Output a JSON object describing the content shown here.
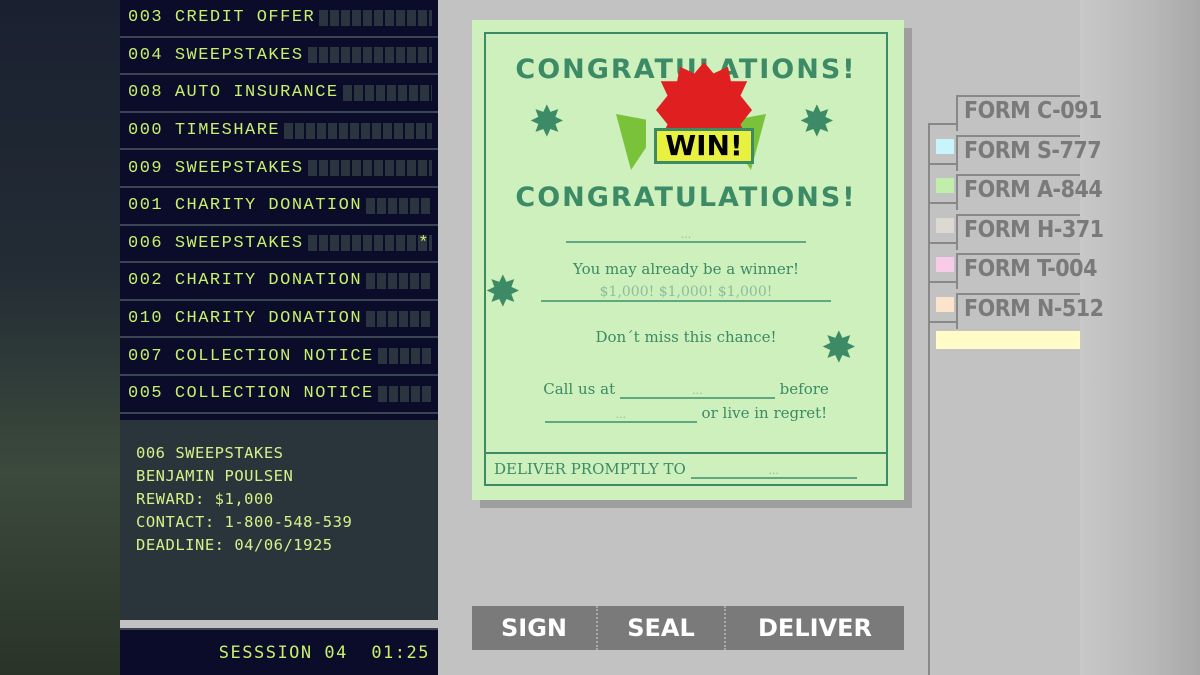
{
  "inbox": [
    {
      "id": "003",
      "title": "CREDIT OFFER",
      "flag": ""
    },
    {
      "id": "004",
      "title": "SWEEPSTAKES",
      "flag": ""
    },
    {
      "id": "008",
      "title": "AUTO INSURANCE",
      "flag": ""
    },
    {
      "id": "000",
      "title": "TIMESHARE",
      "flag": ""
    },
    {
      "id": "009",
      "title": "SWEEPSTAKES",
      "flag": ""
    },
    {
      "id": "001",
      "title": "CHARITY DONATION",
      "flag": ""
    },
    {
      "id": "006",
      "title": "SWEEPSTAKES",
      "flag": "*"
    },
    {
      "id": "002",
      "title": "CHARITY DONATION",
      "flag": ""
    },
    {
      "id": "010",
      "title": "CHARITY DONATION",
      "flag": ""
    },
    {
      "id": "007",
      "title": "COLLECTION NOTICE",
      "flag": ""
    },
    {
      "id": "005",
      "title": "COLLECTION NOTICE",
      "flag": ""
    }
  ],
  "detail": {
    "line1": "006 SWEEPSTAKES",
    "line2": "BENJAMIN POULSEN",
    "line3": "REWARD: $1,000",
    "line4": "CONTACT: 1-800-548-539",
    "line5": "DEADLINE: 04/06/1925"
  },
  "session": "SESSSION 04  01:25",
  "form": {
    "heading1": "CONGRATULATIONS!",
    "heading2": "CONGRATULATIONS!",
    "badge": "WIN!",
    "blank": "...",
    "line1": "You may already be a winner!",
    "amount": "$1,000! $1,000! $1,000!",
    "line2": "Don´t miss this chance!",
    "call": "Call us at",
    "before": "before",
    "regret": "or live in regret!",
    "deliver": "DELIVER PROMPTLY TO"
  },
  "actions": {
    "sign": "SIGN",
    "seal": "SEAL",
    "deliver": "DELIVER"
  },
  "form_tabs": [
    {
      "label": "FORM C-091",
      "color": ""
    },
    {
      "label": "FORM S-777",
      "color": "#c8f4fc"
    },
    {
      "label": "FORM A-844",
      "color": "#c2eeac"
    },
    {
      "label": "FORM H-371",
      "color": "#dcd8d4"
    },
    {
      "label": "FORM T-004",
      "color": "#f8cce8"
    },
    {
      "label": "FORM N-512",
      "color": "#fce4cc"
    }
  ],
  "colors": {
    "lcd_text": "#c8f06a",
    "paper": "#cdf0bc",
    "ink": "#3c8a66"
  }
}
